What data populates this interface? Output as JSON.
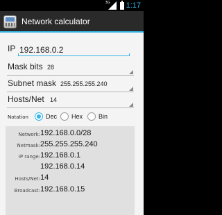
{
  "status_bar": {
    "network_type": "3G",
    "time": "1:17"
  },
  "action_bar": {
    "title": "Network calculator",
    "icon": "calculator-app-icon"
  },
  "ip": {
    "label": "IP",
    "value": "192.168.0.2"
  },
  "mask_bits": {
    "label": "Mask bits",
    "value": "28"
  },
  "subnet_mask": {
    "label": "Subnet mask",
    "value": "255.255.255.240"
  },
  "hosts_net": {
    "label": "Hosts/Net",
    "value": "14"
  },
  "notation": {
    "label": "Notation",
    "options": [
      {
        "label": "Dec",
        "checked": true
      },
      {
        "label": "Hex",
        "checked": false
      },
      {
        "label": "Bin",
        "checked": false
      }
    ]
  },
  "results": {
    "network": {
      "label": "Network:",
      "value": "192.168.0.0/28"
    },
    "netmask": {
      "label": "Netmask:",
      "value": "255.255.255.240"
    },
    "ip_range": {
      "label": "IP range:",
      "start": "192.168.0.1",
      "end": "192.168.0.14"
    },
    "hosts_net": {
      "label": "Hosts/Net:",
      "value": "14"
    },
    "broadcast": {
      "label": "Broadcast:",
      "value": "192.168.0.15"
    }
  },
  "colors": {
    "accent": "#33b5e5",
    "action_bar": "#2a2a2a",
    "background": "#f4f4f4",
    "results_panel": "#e0e0e0"
  }
}
